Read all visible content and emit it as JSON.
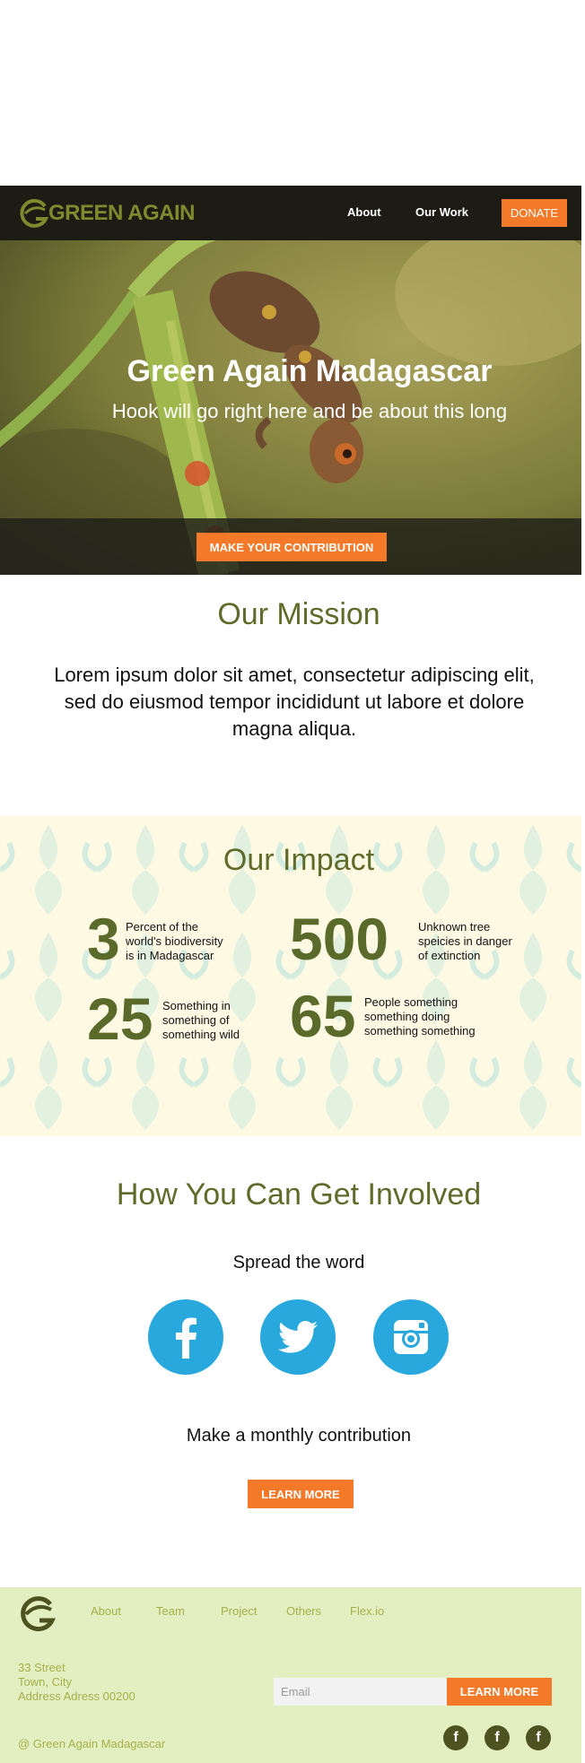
{
  "colors": {
    "brand_green": "#5f6b2a",
    "accent_orange": "#f47a2a",
    "social_blue": "#29a8dd",
    "footer_bg": "#e4efc1",
    "nav_bg": "#1c1c14"
  },
  "nav": {
    "logo_text": "GREEN AGAIN",
    "links": [
      "About",
      "Our Work"
    ],
    "donate_label": "DONATE"
  },
  "hero": {
    "title": "Green Again Madagascar",
    "subtitle": "Hook will go right here and be about this long",
    "cta_label": "MAKE YOUR CONTRIBUTION"
  },
  "mission": {
    "title": "Our Mission",
    "text": "Lorem ipsum dolor sit amet, consectetur adipiscing elit, sed do eiusmod tempor incididunt ut labore et dolore magna aliqua."
  },
  "impact": {
    "title": "Our Impact",
    "stats": [
      {
        "number": "3",
        "label": "Percent of the world's biodiversity is in Madagascar"
      },
      {
        "number": "500",
        "label": "Unknown tree speicies in danger of extinction"
      },
      {
        "number": "25",
        "label": "Something in something of something wild"
      },
      {
        "number": "65",
        "label": "People something something doing something something"
      }
    ]
  },
  "involved": {
    "title": "How You Can Get Involved",
    "spread_label": "Spread the word",
    "social_icons": [
      "facebook-icon",
      "twitter-icon",
      "instagram-icon"
    ],
    "monthly_label": "Make a monthly contribution",
    "learn_more_label": "LEARN MORE"
  },
  "footer": {
    "links": [
      "About",
      "Team",
      "Project",
      "Others",
      "Flex.io"
    ],
    "address": [
      "33 Street",
      "Town, City",
      "Address Adress 00200"
    ],
    "email_placeholder": "Email",
    "learn_more_label": "LEARN MORE",
    "copyright": "@ Green Again Madagascar",
    "social_icons": [
      "facebook-icon",
      "facebook-icon",
      "facebook-icon"
    ]
  }
}
